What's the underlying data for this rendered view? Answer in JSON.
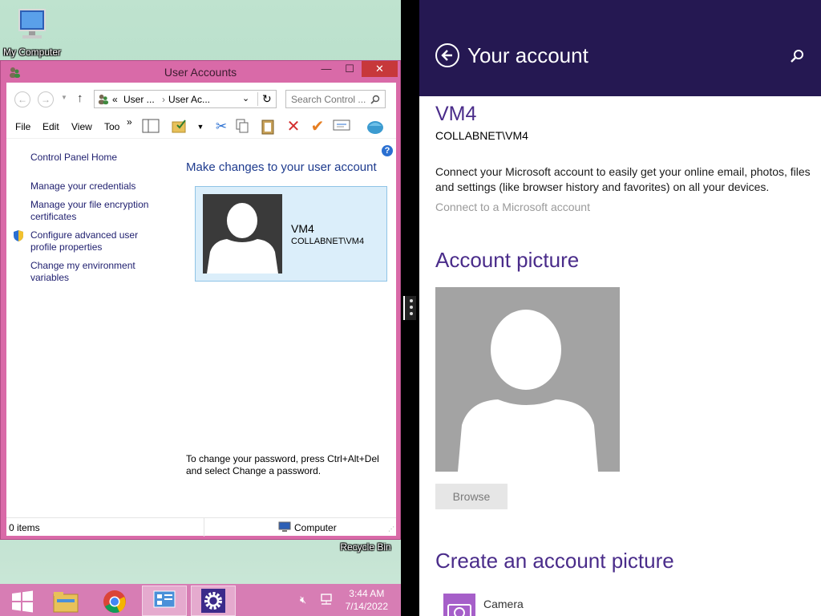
{
  "desktop": {
    "icons": [
      {
        "label": "My Computer"
      },
      {
        "label": "Recycle Bin"
      }
    ]
  },
  "window": {
    "title": "User Accounts",
    "controls": {
      "minimize": "—",
      "maximize": "☐",
      "close": "✕"
    },
    "address": {
      "prefix": "«",
      "crumb1": "User ...",
      "sep": "›",
      "crumb2": "User Ac..."
    },
    "search_placeholder": "Search Control ...",
    "menu": [
      "File",
      "Edit",
      "View",
      "Too"
    ],
    "menu_more": "»",
    "left_links": {
      "home": "Control Panel Home",
      "credentials": "Manage your credentials",
      "encryption": "Manage your file encryption certificates",
      "advanced": "Configure advanced user profile properties",
      "environment": "Change my environment variables"
    },
    "heading": "Make changes to your user account",
    "user": {
      "name": "VM4",
      "domain": "COLLABNET\\VM4"
    },
    "password_note": "To change your password, press Ctrl+Alt+Del and select Change a password.",
    "status": {
      "items": "0 items",
      "zone": "Computer"
    }
  },
  "taskbar": {
    "time": "3:44 AM",
    "date": "7/14/2022"
  },
  "settings": {
    "title": "Your account",
    "account_name": "VM4",
    "account_domain": "COLLABNET\\VM4",
    "description": "Connect your Microsoft account to easily get your online email, photos, files and settings (like browser history and favorites) on all your devices.",
    "connect_link": "Connect to a Microsoft account",
    "picture_heading": "Account picture",
    "browse_label": "Browse",
    "create_heading": "Create an account picture",
    "camera_label": "Camera"
  },
  "colors": {
    "window_frame": "#d96aa8",
    "taskbar": "#d77db4",
    "settings_header": "#251852",
    "accent_purple": "#4a2c8a"
  }
}
